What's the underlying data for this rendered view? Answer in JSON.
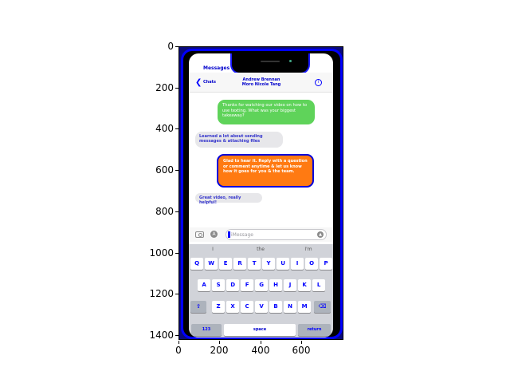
{
  "axes": {
    "y_ticks": [
      "0",
      "200",
      "400",
      "600",
      "800",
      "1000",
      "1200",
      "1400"
    ],
    "x_ticks": [
      "0",
      "200",
      "400",
      "600"
    ]
  },
  "phone": {
    "status_time": "Messages",
    "header": {
      "back_label": "Chats",
      "contact_line1": "Andrew Brennan",
      "contact_line2": "Moro Nicole Tang"
    },
    "messages": [
      {
        "side": "right",
        "text": "Thanks for watching our video on how to use texting. What was your biggest takeaway?",
        "color": "#5fd35a"
      },
      {
        "side": "left",
        "text": "Learned a lot about sending messages & attaching files"
      },
      {
        "side": "right",
        "text": "Glad to hear it. Reply with a question or comment anytime & let us know how it goes for you & the team."
      },
      {
        "side": "left",
        "text": "Great video, really helpful!"
      }
    ],
    "input": {
      "placeholder": "iMessage"
    },
    "suggestions": [
      "I",
      "the",
      "I'm"
    ],
    "rows": [
      [
        "Q",
        "W",
        "E",
        "R",
        "T",
        "Y",
        "U",
        "I",
        "O",
        "P"
      ],
      [
        "A",
        "S",
        "D",
        "F",
        "G",
        "H",
        "J",
        "K",
        "L"
      ],
      [
        "Z",
        "X",
        "C",
        "V",
        "B",
        "N",
        "M"
      ]
    ],
    "bottom": {
      "numbers": "123",
      "space": "space",
      "return": "return"
    }
  }
}
